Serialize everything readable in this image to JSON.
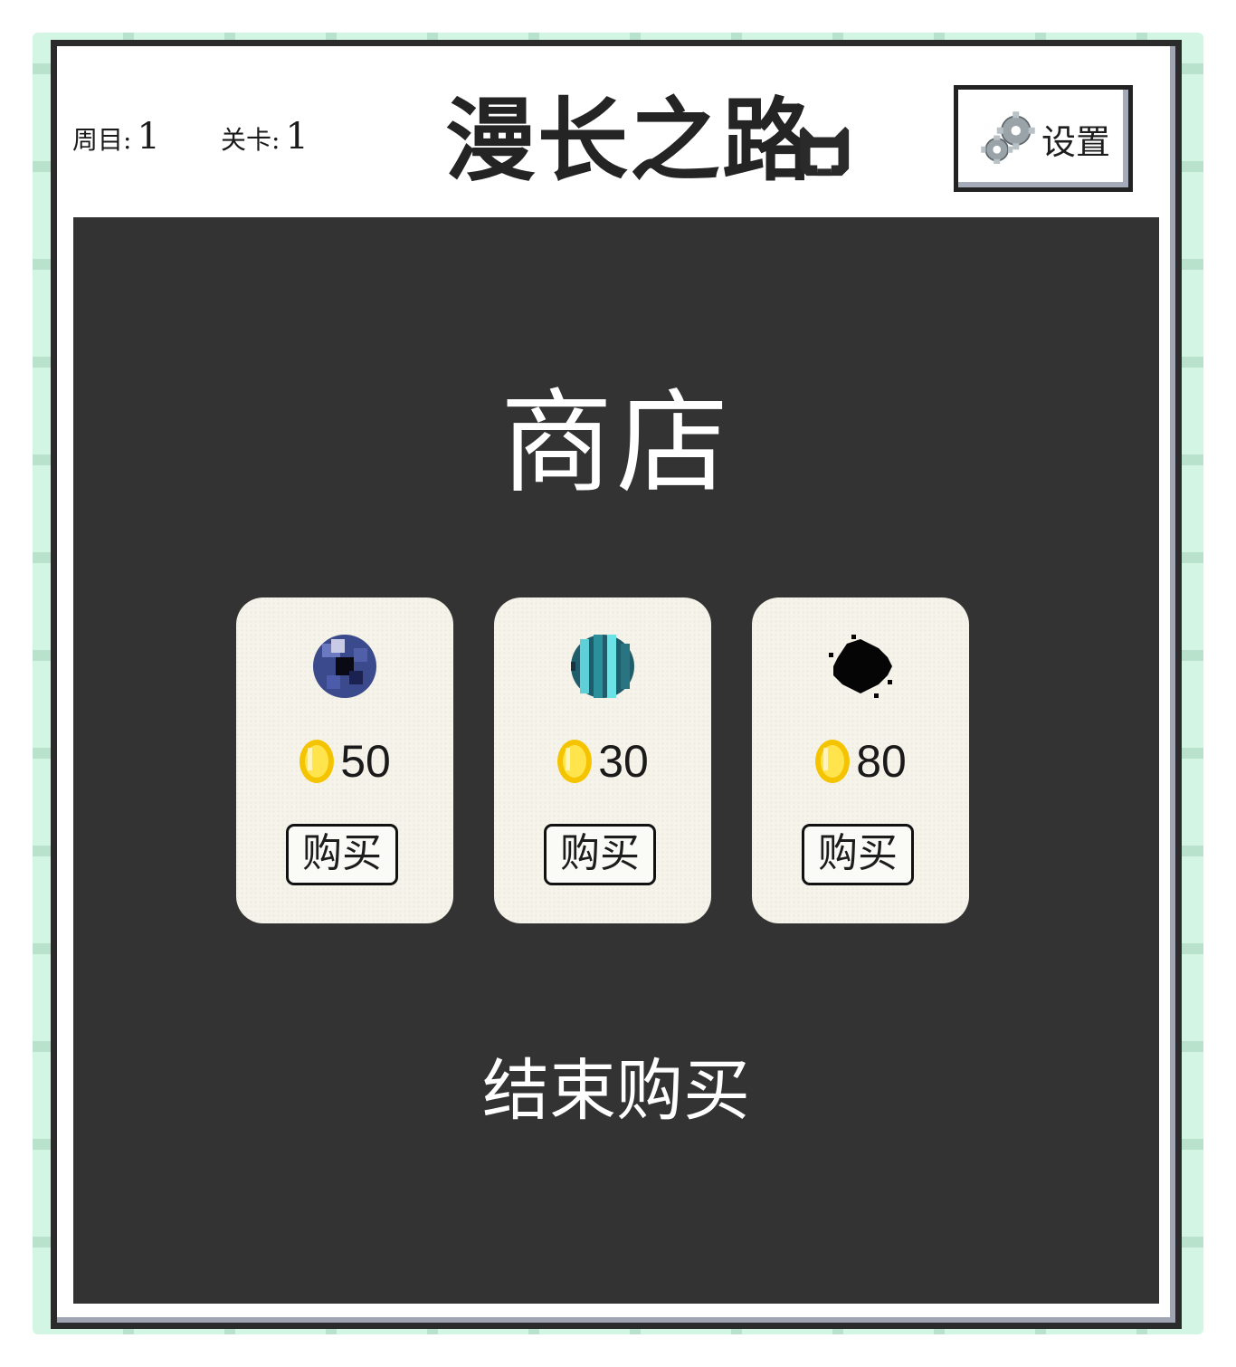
{
  "header": {
    "week_label": "周目:",
    "week_value": "1",
    "level_label": "关卡:",
    "level_value": "1",
    "title": "漫长之路",
    "settings_label": "设置"
  },
  "shop": {
    "title": "商店",
    "items": [
      {
        "icon": "dark-blue-orb-icon",
        "price": "50",
        "buy_label": "购买"
      },
      {
        "icon": "teal-striped-orb-icon",
        "price": "30",
        "buy_label": "购买"
      },
      {
        "icon": "black-blob-icon",
        "price": "80",
        "buy_label": "购买"
      }
    ],
    "finish_label": "结束购买"
  },
  "colors": {
    "panel": "#333333",
    "card": "#f6f4ea",
    "frame": "#d2f6e3",
    "coin": "#ffd400"
  }
}
